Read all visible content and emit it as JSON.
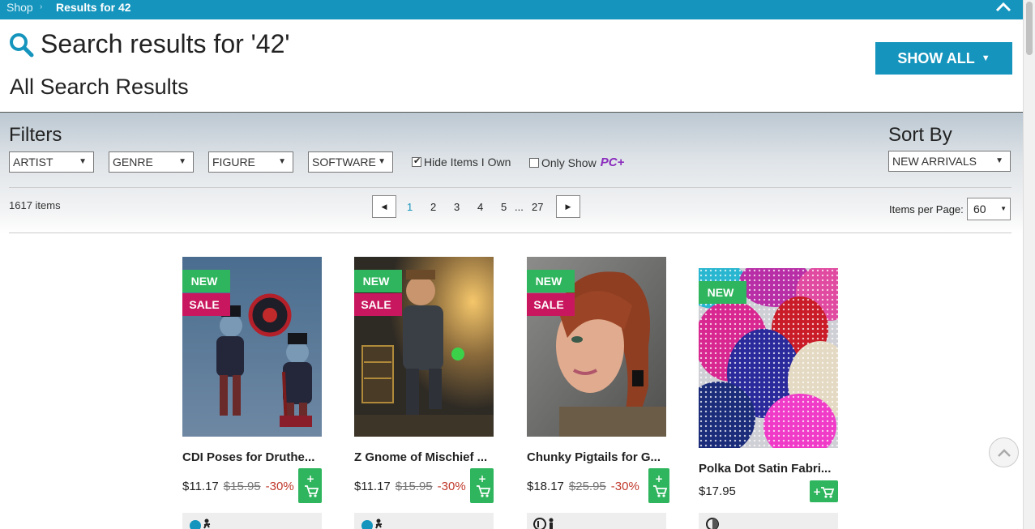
{
  "breadcrumb": {
    "shop": "Shop",
    "separator": "›",
    "current": "Results for 42"
  },
  "header": {
    "title": "Search results for '42'",
    "subtitle": "All Search Results",
    "show_all": "SHOW ALL"
  },
  "filters": {
    "title": "Filters",
    "dropdowns": [
      "ARTIST",
      "GENRE",
      "FIGURE",
      "SOFTWARE"
    ],
    "hide_owned": "Hide Items I Own",
    "only_show": "Only Show",
    "pc_logo": "PC+"
  },
  "sort": {
    "title": "Sort By",
    "selected": "NEW ARRIVALS"
  },
  "results": {
    "count": "1617 items",
    "per_page_label": "Items per Page:",
    "per_page": "60"
  },
  "pagination": {
    "pages": [
      "1",
      "2",
      "3",
      "4",
      "5"
    ],
    "ellipsis": "...",
    "last": "27",
    "current": "1"
  },
  "colors": {
    "accent": "#1595bd",
    "new_badge": "#2fb55d",
    "sale_badge": "#c8175e",
    "discount": "#c0392b",
    "pc_purple": "#8a2bbd"
  },
  "products": [
    {
      "name": "CDI Poses for Druthe...",
      "price": "$11.17",
      "old_price": "$15.95",
      "discount": "-30%",
      "badge_new": "NEW",
      "badge_sale": "SALE"
    },
    {
      "name": "Z Gnome of Mischief ...",
      "price": "$11.17",
      "old_price": "$15.95",
      "discount": "-30%",
      "badge_new": "NEW",
      "badge_sale": "SALE"
    },
    {
      "name": "Chunky Pigtails for G...",
      "price": "$18.17",
      "old_price": "$25.95",
      "discount": "-30%",
      "badge_new": "NEW",
      "badge_sale": "SALE"
    },
    {
      "name": "Polka Dot Satin Fabri...",
      "price": "$17.95",
      "badge_new": "NEW"
    }
  ]
}
